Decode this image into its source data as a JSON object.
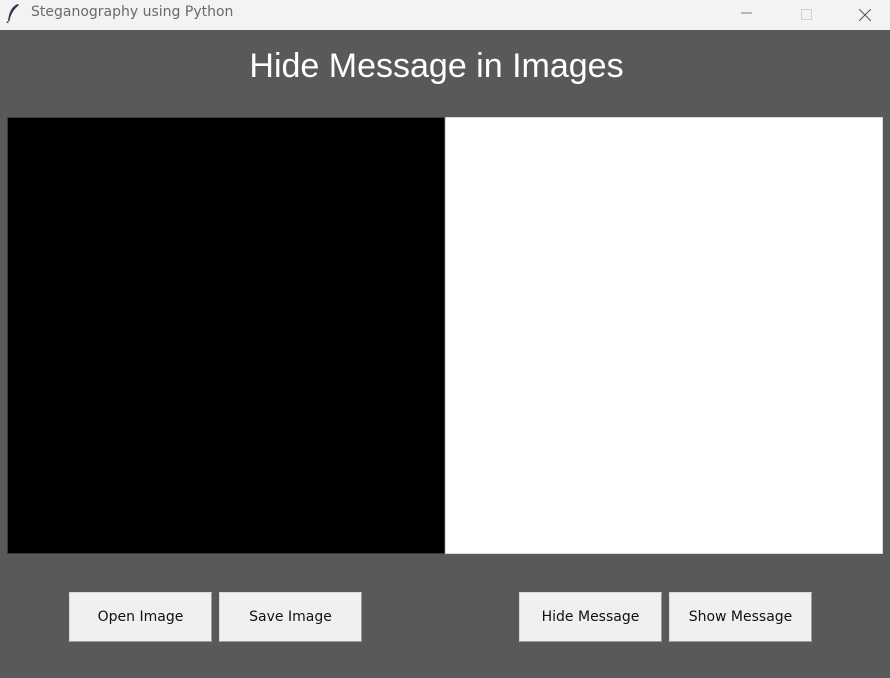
{
  "window": {
    "title": "Steganography using Python",
    "icon": "feather-icon",
    "controls": [
      "minimize-icon",
      "maximize-icon",
      "close-icon"
    ]
  },
  "main": {
    "heading": "Hide Message in Images",
    "canvas_left_color": "#000000",
    "canvas_right_color": "#ffffff"
  },
  "buttons": {
    "open_image": "Open Image",
    "save_image": "Save Image",
    "hide_message": "Hide Message",
    "show_message": "Show Message"
  },
  "colors": {
    "background": "#595959",
    "titlebar": "#f3f3f3",
    "button_face": "#f0f0f0",
    "heading_text": "#ffffff"
  }
}
